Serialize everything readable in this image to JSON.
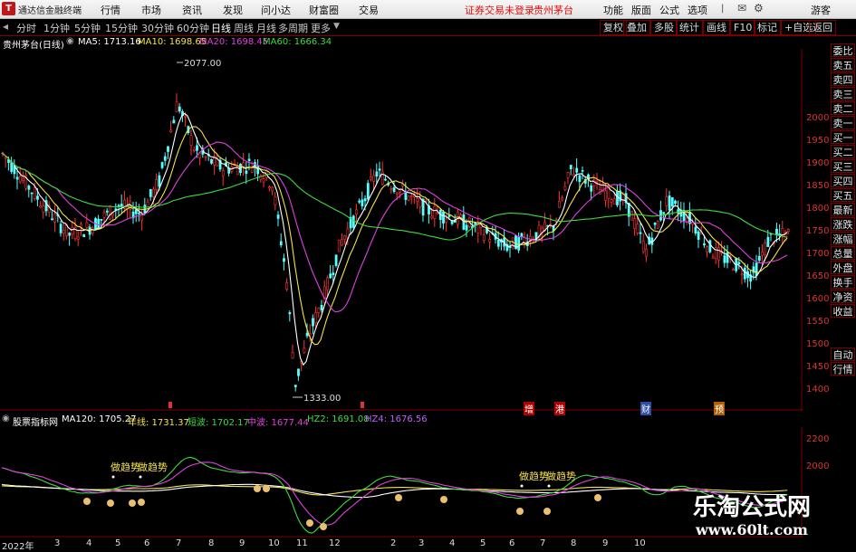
{
  "app": {
    "title": "通达信金融终端",
    "logo_text": "T",
    "menus": [
      "行情",
      "市场",
      "资讯",
      "发现",
      "问小达",
      "财富圈",
      "交易"
    ],
    "notice": "证券交易未登录",
    "stock_tag": "贵州茅台",
    "right_menus": [
      "功能",
      "版面",
      "公式",
      "选项"
    ],
    "brand": "游客"
  },
  "toolbar": {
    "periods": [
      "分时",
      "1分钟",
      "5分钟",
      "15分钟",
      "30分钟",
      "60分钟",
      "日线",
      "周线",
      "月线",
      "多周期",
      "更多"
    ],
    "active_period": "日线",
    "buttons": [
      "复权",
      "叠加",
      "多股",
      "统计",
      "画线",
      "F10",
      "标记",
      "+自选",
      "返回"
    ]
  },
  "main_chart": {
    "title": "贵州茅台(日线)",
    "ma": [
      {
        "label": "MA5: 1713.16",
        "color": "#ffffff"
      },
      {
        "label": "MA10: 1698.65",
        "color": "#f5e24a"
      },
      {
        "label": "MA20: 1698.45",
        "color": "#e040e0"
      },
      {
        "label": "MA60: 1666.34",
        "color": "#3ddc3d"
      }
    ],
    "price_axis": [
      "2000",
      "1950",
      "1900",
      "1850",
      "1800",
      "1750",
      "1700",
      "1650",
      "1600",
      "1550",
      "1500",
      "1450",
      "1400"
    ],
    "high_label": "2077.00",
    "low_label": "1333.00",
    "event_markers": [
      "增",
      "港",
      "财",
      "预"
    ]
  },
  "side_panel": [
    "委比",
    "卖五",
    "卖四",
    "卖三",
    "卖二",
    "卖一",
    "买一",
    "买二",
    "买三",
    "买四",
    "买五",
    "最新",
    "涨跌",
    "涨幅",
    "总量",
    "外盘",
    "换手",
    "净资",
    "收益",
    "自动",
    "行情"
  ],
  "indicator": {
    "name": "股票指标网",
    "lines": [
      {
        "label": "MA120: 1705.27",
        "color": "#ffffff"
      },
      {
        "label": "年线: 1731.37",
        "color": "#f5e24a"
      },
      {
        "label": "短波: 1702.17",
        "color": "#3ddc3d"
      },
      {
        "label": "中波: 1677.44",
        "color": "#e040e0"
      },
      {
        "label": "HZ2: 1691.08",
        "color": "#3ddc3d"
      },
      {
        "label": "HZ4: 1676.56",
        "color": "#c060ff"
      }
    ],
    "axis": [
      "2200",
      "2000"
    ],
    "signal_label": "做趋势",
    "signal_icon": "money-bag-icon"
  },
  "x_axis": [
    "2022年",
    "3",
    "4",
    "5",
    "6",
    "7",
    "8",
    "9",
    "10",
    "11",
    "12",
    "2",
    "3",
    "4",
    "5",
    "6",
    "7",
    "8",
    "9",
    "10"
  ],
  "watermark": {
    "line1": "乐淘公式网",
    "line2": "www.60lt.com"
  }
}
